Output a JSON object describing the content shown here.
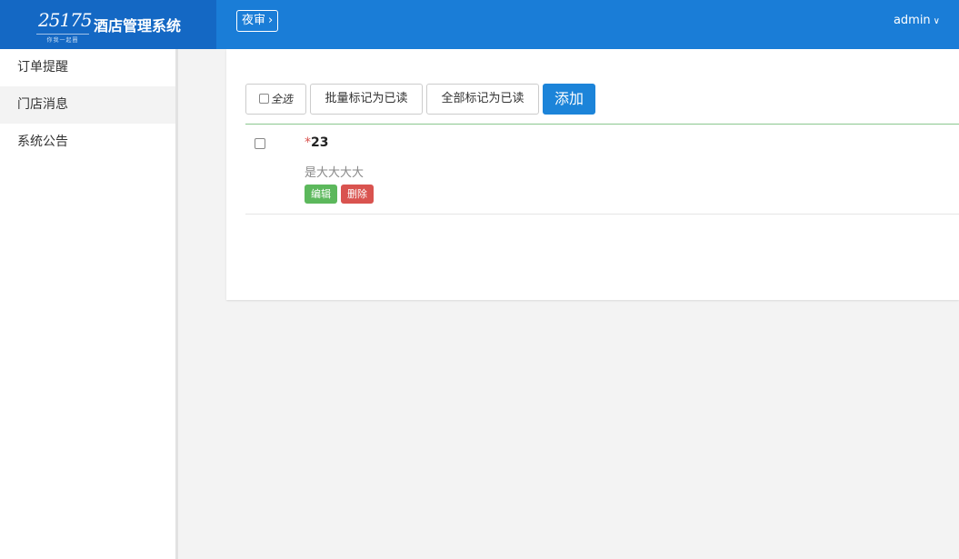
{
  "header": {
    "logo_number": "25175",
    "logo_tagline": "你我一起圈",
    "app_title": "酒店管理系统",
    "night_audit": "夜审",
    "user": "admin"
  },
  "sidebar": {
    "items": [
      {
        "label": "订单提醒"
      },
      {
        "label": "门店消息"
      },
      {
        "label": "系统公告"
      }
    ]
  },
  "toolbar": {
    "select_all": "全选",
    "mark_selected_read": "批量标记为已读",
    "mark_all_read": "全部标记为已读",
    "add": "添加"
  },
  "messages": [
    {
      "title": "23",
      "content": "是大大大大",
      "edit": "编辑",
      "delete": "删除"
    }
  ],
  "colors": {
    "header": "#1a7dd7",
    "brand": "#1468c4",
    "primary": "#1c84d9",
    "success": "#5cb85c",
    "danger": "#d9534f"
  }
}
